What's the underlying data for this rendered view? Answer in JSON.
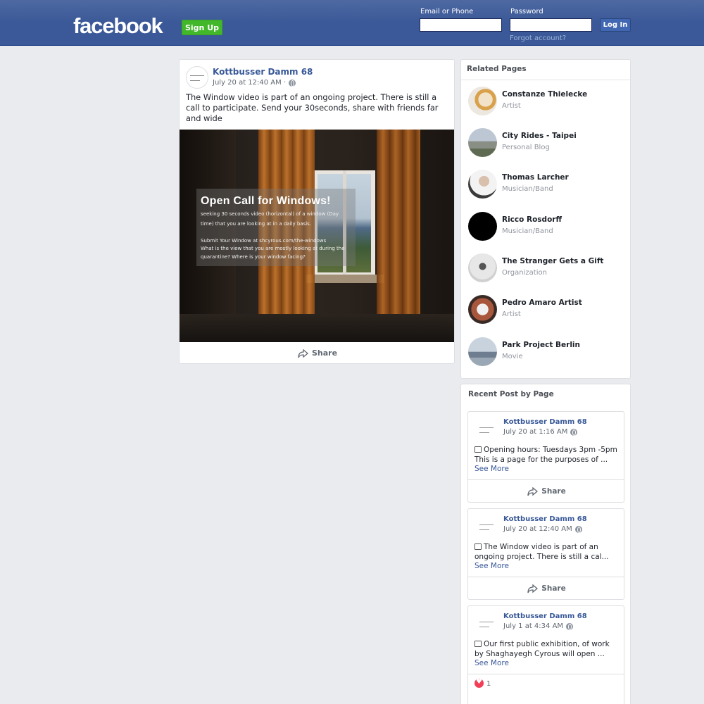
{
  "header": {
    "logo": "facebook",
    "signup_label": "Sign Up",
    "email_label": "Email or Phone",
    "password_label": "Password",
    "email_value": "",
    "password_value": "",
    "login_label": "Log In",
    "forgot_label": "Forgot account?"
  },
  "post": {
    "page_name": "Kottbusser Damm 68",
    "date": "July 20 at 12:40 AM ·",
    "text": "The Window video is part of an ongoing project. There is still a call to participate. Send your 30seconds, share with friends far and wide",
    "image": {
      "title": "Open Call for Windows!",
      "lines": [
        "seeking 30 seconds video (horizontal) of a window (Day",
        "time) that you are looking at in a daily basis.",
        "",
        "Submit Your Window at shcyrous.com/the-windows",
        "What is the view that you are mostly looking at during the",
        "quarantine? Where is your window facing?"
      ]
    },
    "share_label": "Share"
  },
  "related": {
    "title": "Related Pages",
    "items": [
      {
        "name": "Constanze Thielecke",
        "category": "Artist"
      },
      {
        "name": "City Rides - Taipei",
        "category": "Personal Blog"
      },
      {
        "name": "Thomas Larcher",
        "category": "Musician/Band"
      },
      {
        "name": "Ricco Rosdorff",
        "category": "Musician/Band"
      },
      {
        "name": "The Stranger Gets a Gift",
        "category": "Organization"
      },
      {
        "name": "Pedro Amaro Artist",
        "category": "Artist"
      },
      {
        "name": "Park Project Berlin",
        "category": "Movie"
      }
    ]
  },
  "recent": {
    "title": "Recent Post by Page",
    "posts": [
      {
        "page_name": "Kottbusser Damm 68",
        "date": "July 20 at 1:16 AM",
        "text": "Opening hours: Tuesdays 3pm -5pm This is a page for the purposes of ...",
        "more": "See More",
        "share": "Share"
      },
      {
        "page_name": "Kottbusser Damm 68",
        "date": "July 20 at 12:40 AM",
        "text": "The Window video is part of an ongoing project. There is still a cal...",
        "more": "See More",
        "share": "Share"
      },
      {
        "page_name": "Kottbusser Damm 68",
        "date": "July 1 at 4:34 AM",
        "text": "Our first public exhibition, of work by Shaghayegh Cyrous will open ...",
        "more": "See More",
        "likes": "1"
      }
    ]
  },
  "colors": {
    "header_bg": "#3b5998",
    "signup_green": "#42b72a",
    "link_blue": "#385898",
    "page_bg": "#e9ebee"
  }
}
